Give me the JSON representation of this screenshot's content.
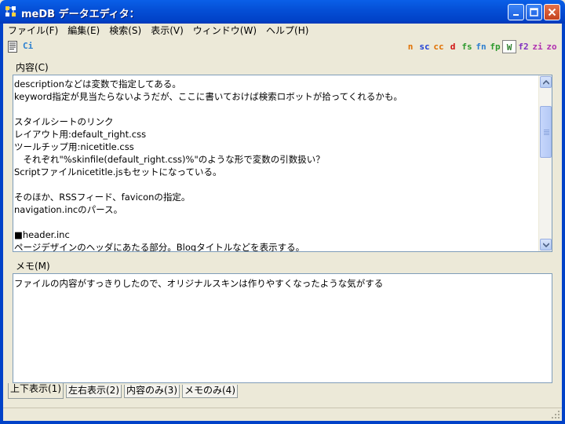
{
  "window": {
    "title": "meDB データエディタ："
  },
  "menubar": {
    "items": [
      {
        "label": "ファイル(F)"
      },
      {
        "label": "編集(E)"
      },
      {
        "label": "検索(S)"
      },
      {
        "label": "表示(V)"
      },
      {
        "label": "ウィンドウ(W)"
      },
      {
        "label": "ヘルプ(H)"
      }
    ]
  },
  "toolbar": {
    "ci_label": "Ci",
    "tools": [
      {
        "label": "n",
        "color": "#E07000"
      },
      {
        "label": "sc",
        "color": "#1E3FD8"
      },
      {
        "label": "cc",
        "color": "#E07000"
      },
      {
        "label": "d",
        "color": "#D01010"
      },
      {
        "label": "fs",
        "color": "#2E9A2E"
      },
      {
        "label": "fn",
        "color": "#2E7FD0"
      },
      {
        "label": "fp",
        "color": "#2E9A2E"
      },
      {
        "label": "W",
        "color": "#2E7F2E"
      },
      {
        "label": "f2",
        "color": "#8030C0"
      },
      {
        "label": "zi",
        "color": "#B030B0"
      },
      {
        "label": "zo",
        "color": "#B030B0"
      }
    ]
  },
  "content": {
    "label": "内容(C)",
    "lines": [
      "descriptionなどは変数で指定してある。",
      "keyword指定が見当たらないようだが、ここに書いておけば検索ロボットが拾ってくれるかも。",
      "",
      "スタイルシートのリンク",
      "レイアウト用:default_right.css",
      "ツールチップ用:nicetitle.css",
      "　それぞれ\"%skinfile(default_right.css)%\"のような形で変数の引数扱い？",
      "Scriptファイルnicetitle.jsもセットになっている。",
      "",
      "そのほか、RSSフィード、faviconの指定。",
      "navigation.incのパース。",
      "",
      "■header.inc",
      "ページデザインのヘッダにあたる部分。Blogタイトルなどを表示する。"
    ]
  },
  "memo": {
    "label": "メモ(M)",
    "lines": [
      "ファイルの内容がすっきりしたので、オリジナルスキンは作りやすくなったような気がする"
    ]
  },
  "tabs": [
    {
      "label": "上下表示(1)",
      "active": true
    },
    {
      "label": "左右表示(2)",
      "active": false
    },
    {
      "label": "内容のみ(3)",
      "active": false
    },
    {
      "label": "メモのみ(4)",
      "active": false
    }
  ]
}
